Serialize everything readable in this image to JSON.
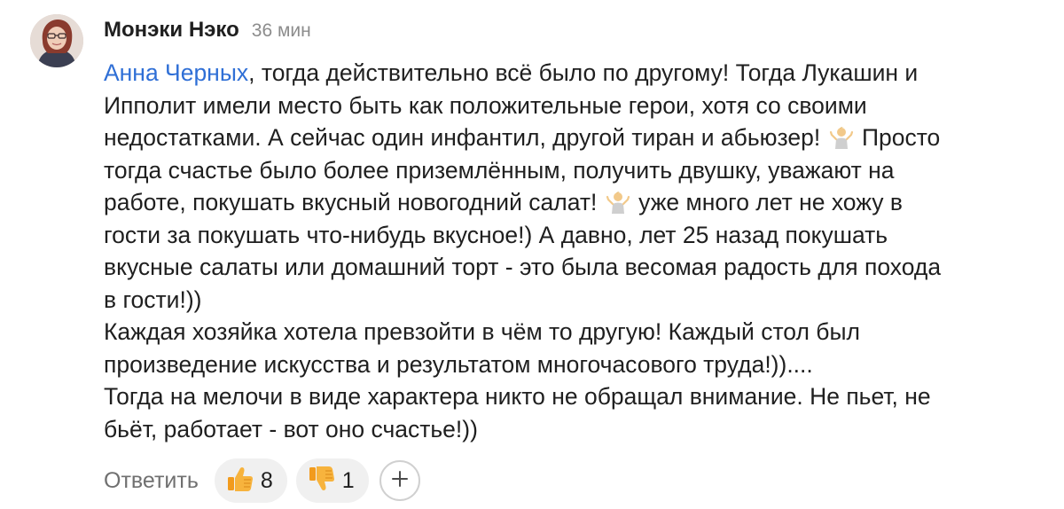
{
  "comment": {
    "author": "Монэки Нэко",
    "time": "36 мин",
    "avatar_icon": "user-avatar",
    "mention": "Анна Черных",
    "lines": [
      ", тогда действительно всё было по другому! Тогда Лукашин и",
      "Ипполит имели место быть как положительные герои, хотя со своими",
      "недостатками. А сейчас один инфантил, другой тиран и абьюзер!",
      "Просто",
      "тогда счастье было более приземлённым, получить двушку, уважают на",
      "работе, покушать вкусный новогодний салат!",
      "уже много лет не хожу в",
      "гости за покушать что-нибудь вкусное!) А давно, лет 25 назад покушать",
      "вкусные салаты или домашний торт - это была весомая радость для похода",
      "в гости!))",
      "Каждая хозяйка хотела превзойти в чём то другую! Каждый стол был",
      "произведение искусства и результатом многочасового труда!))....",
      "Тогда на мелочи в виде характера никто не обращал внимание. Не пьет, не",
      "бьёт, работает - вот оно счастье!))"
    ],
    "emoji_icon": "person-shrugging-icon"
  },
  "actions": {
    "reply_label": "Ответить",
    "like_icon": "thumbs-up-icon",
    "like_count": "8",
    "dislike_icon": "thumbs-down-icon",
    "dislike_count": "1",
    "add_reaction_icon": "plus-icon"
  },
  "colors": {
    "mention": "#2f6fd6",
    "text": "#1f1f1f",
    "muted": "#8c8c8c",
    "pill_bg": "#f0f0f0"
  }
}
